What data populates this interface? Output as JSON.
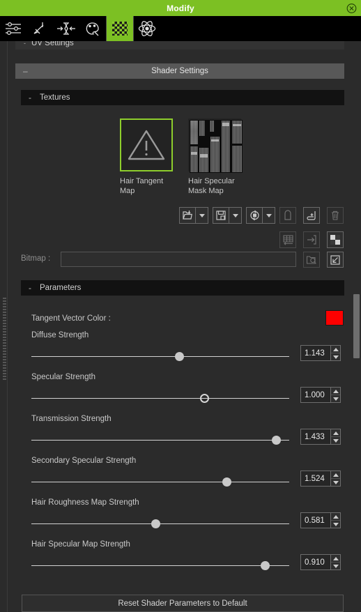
{
  "window": {
    "title": "Modify",
    "close_icon": "close-circle-icon",
    "titlebar_color": "#7cc023"
  },
  "toolbar": {
    "items": [
      {
        "name": "sliders-icon",
        "label": "Adjust",
        "active": false
      },
      {
        "name": "transform-icon",
        "label": "Transform",
        "active": false
      },
      {
        "name": "align-icon",
        "label": "Align",
        "active": false
      },
      {
        "name": "palette-icon",
        "label": "Material",
        "active": false
      },
      {
        "name": "checker-icon",
        "label": "Texture",
        "active": true
      },
      {
        "name": "atom-icon",
        "label": "Physics",
        "active": false
      }
    ]
  },
  "sections": {
    "uv_settings": {
      "label": "UV Settings",
      "collapse_glyph": "-"
    },
    "shader_settings": {
      "label": "Shader Settings",
      "collapse_glyph": "–"
    },
    "textures": {
      "label": "Textures",
      "collapse_glyph": "-"
    },
    "parameters": {
      "label": "Parameters",
      "collapse_glyph": "-"
    }
  },
  "textures": {
    "items": [
      {
        "caption": "Hair Tangent\nMap",
        "caption_l1": "Hair Tangent",
        "caption_l2": "Map",
        "icon": "warning-triangle-icon",
        "selected": true
      },
      {
        "caption": "Hair Specular\nMask Map",
        "caption_l1": "Hair Specular",
        "caption_l2": "Mask Map",
        "icon": "hair-texture-preview",
        "selected": false
      }
    ]
  },
  "texture_tools": {
    "row1": [
      {
        "name": "load-texture-button",
        "icon": "folder-import-icon",
        "has_dropdown": true,
        "enabled": true
      },
      {
        "name": "save-texture-button",
        "icon": "floppy-save-icon",
        "has_dropdown": true,
        "enabled": true
      },
      {
        "name": "refresh-texture-button",
        "icon": "refresh-cycle-icon",
        "has_dropdown": true,
        "enabled": true
      },
      {
        "name": "copy-texture-button",
        "icon": "copy-icon",
        "has_dropdown": false,
        "enabled": false
      },
      {
        "name": "paste-texture-button",
        "icon": "paste-arrow-icon",
        "has_dropdown": false,
        "enabled": true
      },
      {
        "name": "delete-texture-button",
        "icon": "trash-icon",
        "has_dropdown": false,
        "enabled": false
      }
    ],
    "row2": [
      {
        "name": "grid-layout-button",
        "icon": "grid-arrow-icon",
        "enabled": false
      },
      {
        "name": "export-square-button",
        "icon": "square-arrow-icon",
        "enabled": false
      },
      {
        "name": "checker-pattern-button",
        "icon": "checker-squares-icon",
        "enabled": true
      }
    ],
    "row3": [
      {
        "name": "browse-bitmap-button",
        "icon": "folder-search-icon",
        "enabled": false
      },
      {
        "name": "pick-bitmap-button",
        "icon": "arrow-into-box-icon",
        "enabled": true
      }
    ]
  },
  "bitmap": {
    "label": "Bitmap :",
    "value": "",
    "placeholder": ""
  },
  "parameters": {
    "color": {
      "label": "Tangent Vector Color :",
      "value": "#fe0000",
      "name": "tangent-vector-color-swatch"
    },
    "sliders": [
      {
        "label": "Diffuse Strength",
        "value": "1.143",
        "percent": 57.5,
        "hollow": false
      },
      {
        "label": "Specular Strength",
        "value": "1.000",
        "percent": 67.0,
        "hollow": true
      },
      {
        "label": "Transmission Strength",
        "value": "1.433",
        "percent": 95.0,
        "hollow": false
      },
      {
        "label": "Secondary Specular Strength",
        "value": "1.524",
        "percent": 76.0,
        "hollow": false
      },
      {
        "label": "Hair Roughness Map Strength",
        "value": "0.581",
        "percent": 48.0,
        "hollow": false
      },
      {
        "label": "Hair Specular Map Strength",
        "value": "0.910",
        "percent": 90.5,
        "hollow": false
      }
    ]
  },
  "footer": {
    "reset_label": "Reset Shader Parameters to Default"
  }
}
